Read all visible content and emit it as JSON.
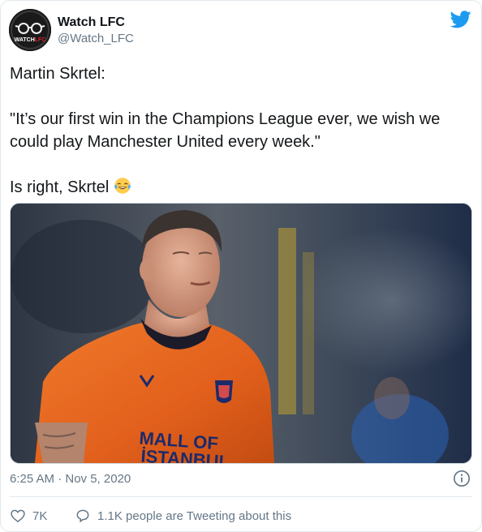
{
  "author": {
    "display_name": "Watch LFC",
    "handle": "@Watch_LFC",
    "avatar_text": "WATCHLFC"
  },
  "tweet": {
    "text": "Martin Skrtel:\n\n\"It’s our first win in the Champions League ever, we wish we could play Manchester United every week.\"\n\nIs right, Skrtel ",
    "emoji": "face-with-tears-of-joy",
    "timestamp": "6:25 AM · Nov 5, 2020"
  },
  "media": {
    "shirt_text_line1": "MALL OF",
    "shirt_text_line2": "İSTANBUL"
  },
  "actions": {
    "likes": "7K",
    "people_tweeting": "1.1K people are Tweeting about this"
  },
  "colors": {
    "twitter_blue": "#1d9bf0",
    "jersey_orange": "#e8661f",
    "text_secondary": "#657786"
  }
}
